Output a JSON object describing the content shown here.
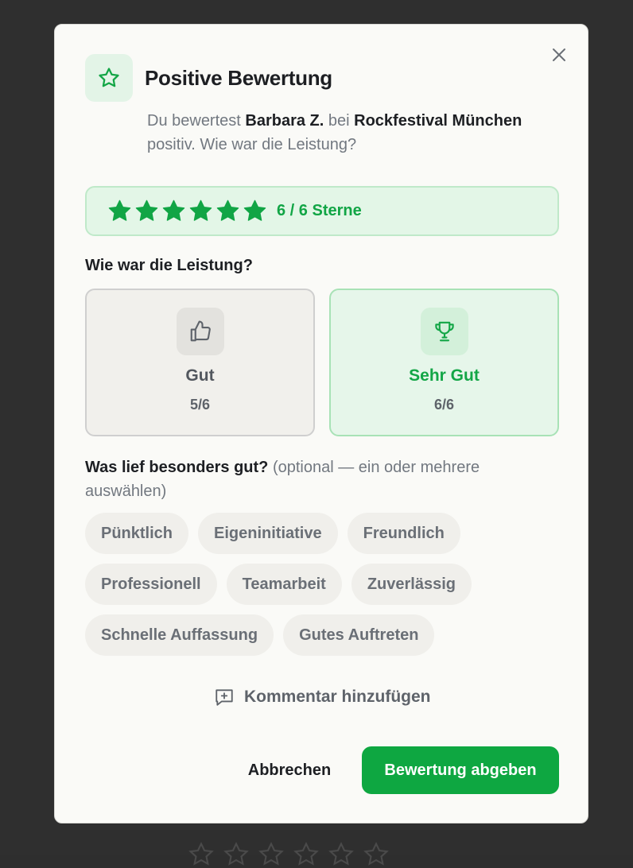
{
  "modal": {
    "title": "Positive Bewertung",
    "subtitle": {
      "prefix": "Du bewertest ",
      "person": "Barbara Z.",
      "middle": " bei ",
      "event": "Rockfestival München",
      "suffix": " positiv. Wie war die Leistung?"
    },
    "header_icon": "star-outline-icon",
    "close_icon": "close-icon"
  },
  "rating": {
    "value": 6,
    "max": 6,
    "label": "6 / 6 Sterne",
    "star_icon": "star-filled-icon",
    "color": "#11a545"
  },
  "performance": {
    "question": "Wie war die Leistung?",
    "options": [
      {
        "label": "Gut",
        "score": "5/6",
        "icon": "thumbs-up-icon",
        "selected": false
      },
      {
        "label": "Sehr Gut",
        "score": "6/6",
        "icon": "trophy-icon",
        "selected": true
      }
    ]
  },
  "highlights": {
    "label": "Was lief besonders gut?",
    "note": " (optional — ein oder mehrere auswählen)",
    "chips": [
      "Pünktlich",
      "Eigeninitiative",
      "Freundlich",
      "Professionell",
      "Teamarbeit",
      "Zuverlässig",
      "Schnelle Auffassung",
      "Gutes Auftreten"
    ]
  },
  "comment": {
    "label": "Kommentar hinzufügen",
    "icon": "comment-plus-icon"
  },
  "footer": {
    "cancel_label": "Abbrechen",
    "submit_label": "Bewertung abgeben",
    "submit_color": "#0ea741"
  }
}
